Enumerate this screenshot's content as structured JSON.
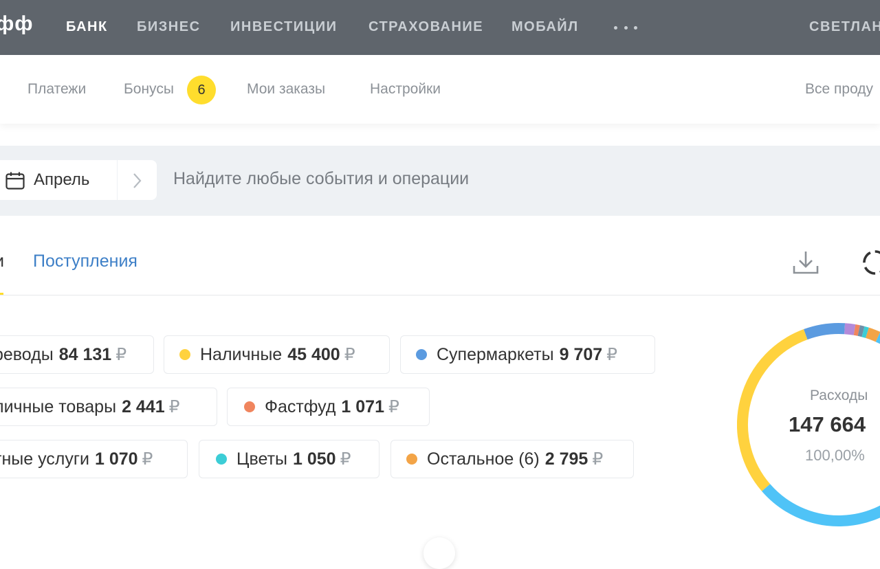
{
  "header": {
    "logo": "фф",
    "nav": [
      "БАНК",
      "БИЗНЕС",
      "ИНВЕСТИЦИИ",
      "СТРАХОВАНИЕ",
      "МОБАЙЛ"
    ],
    "user_name": "СВЕТЛАН"
  },
  "subnav": {
    "items": [
      "Платежи",
      "Бонусы",
      "Мои заказы",
      "Настройки"
    ],
    "bonus_count": "6",
    "all_products": "Все проду"
  },
  "search": {
    "month": "Апрель",
    "placeholder": "Найдите любые события и операции"
  },
  "tabs": {
    "expenses_partial": "и",
    "income": "Поступления"
  },
  "categories": [
    {
      "name": "реводы",
      "amount": "84 131",
      "currency": "₽",
      "color": "#4fc3f7"
    },
    {
      "name": "Наличные",
      "amount": "45 400",
      "currency": "₽",
      "color": "#ffd23e"
    },
    {
      "name": "Супермаркеты",
      "amount": "9 707",
      "currency": "₽",
      "color": "#5b9be0"
    },
    {
      "name": "личные товары",
      "amount": "2 441",
      "currency": "₽",
      "color": "#b38ad9"
    },
    {
      "name": "Фастфуд",
      "amount": "1 071",
      "currency": "₽",
      "color": "#f0855e"
    },
    {
      "name": "тные услуги",
      "amount": "1 070",
      "currency": "₽",
      "color": "#6e8fa8"
    },
    {
      "name": "Цветы",
      "amount": "1 050",
      "currency": "₽",
      "color": "#3ccdd6"
    },
    {
      "name": "Остальное (6)",
      "amount": "2 795",
      "currency": "₽",
      "color": "#f3a447"
    }
  ],
  "summary": {
    "label": "Расходы",
    "total": "147 664",
    "percent": "100,00%"
  },
  "chart_data": {
    "type": "pie",
    "title": "Расходы",
    "total": 147664,
    "categories": [
      "Переводы",
      "Наличные",
      "Супермаркеты",
      "Личные товары",
      "Фастфуд",
      "Платные услуги",
      "Цветы",
      "Остальное (6)"
    ],
    "values": [
      84131,
      45400,
      9707,
      2441,
      1071,
      1070,
      1050,
      2795
    ],
    "colors": [
      "#4fc3f7",
      "#ffd23e",
      "#5b9be0",
      "#b38ad9",
      "#f0855e",
      "#6e8fa8",
      "#3ccdd6",
      "#f3a447"
    ]
  }
}
